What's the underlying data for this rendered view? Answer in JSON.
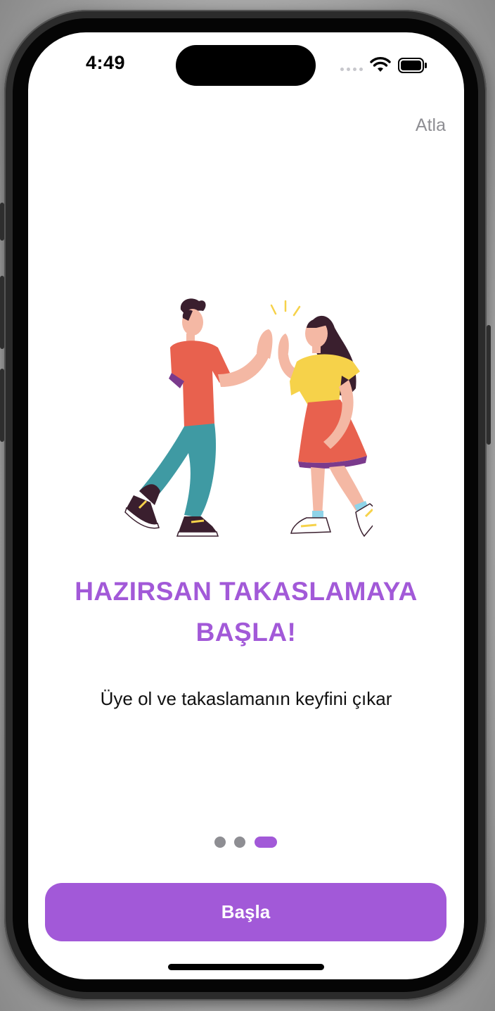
{
  "status_bar": {
    "time": "4:49",
    "icons": [
      "cellular-signal-icon",
      "wifi-icon",
      "battery-icon"
    ]
  },
  "header": {
    "skip_label": "Atla"
  },
  "illustration": {
    "icon": "two-people-high-five-illustration"
  },
  "onboarding": {
    "title": "HAZIRSAN TAKASLAMAYA BAŞLA!",
    "subtitle": "Üye ol ve takaslamanın keyfini çıkar",
    "page_count": 3,
    "current_page": 3
  },
  "actions": {
    "start_label": "Başla"
  },
  "colors": {
    "accent": "#a259d8",
    "dot_inactive": "#8e8e93",
    "skip_text": "#8e8e93",
    "background": "#ffffff"
  }
}
